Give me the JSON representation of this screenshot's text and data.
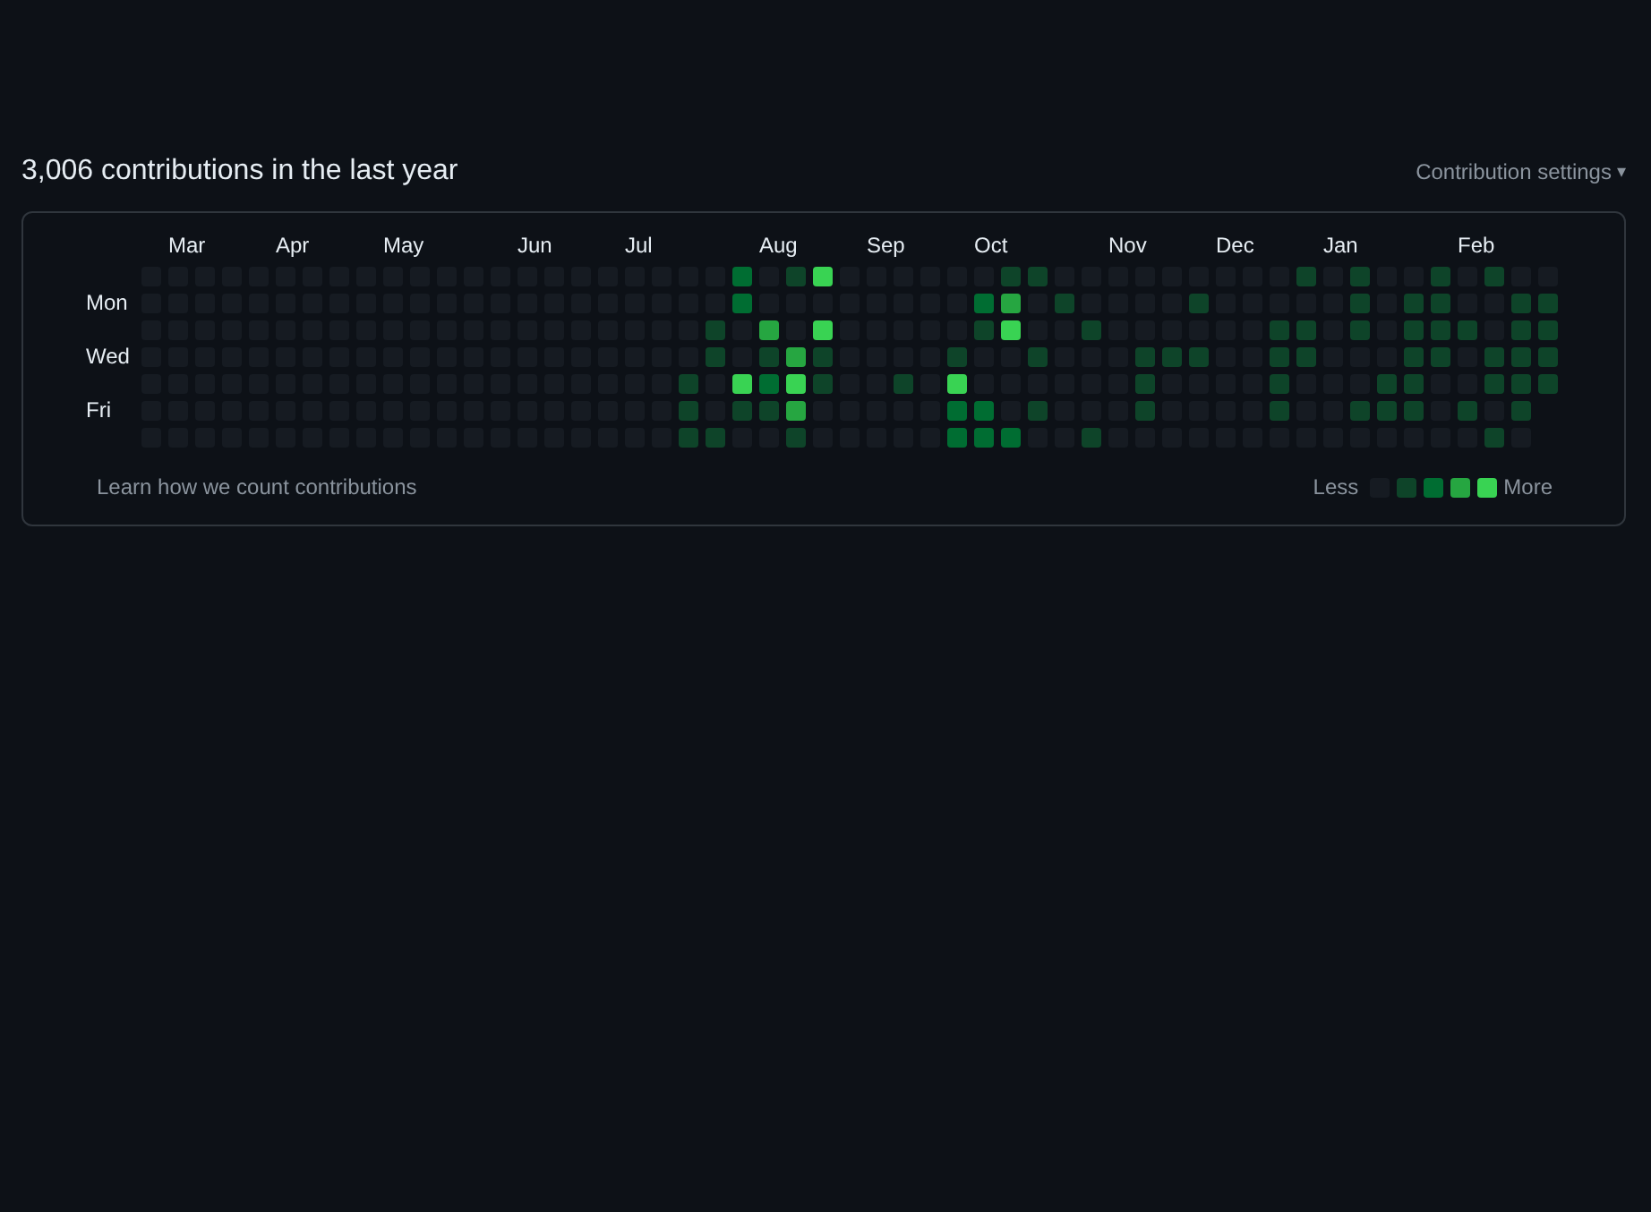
{
  "heading": "3,006 contributions in the last year",
  "settings_menu": {
    "label": "Contribution settings",
    "caret": "▾"
  },
  "weekday_rows": [
    {},
    {
      "label": "Mon"
    },
    {},
    {
      "label": "Wed"
    },
    {},
    {
      "label": "Fri"
    },
    {}
  ],
  "weeks": [
    {
      "days": [
        {
          "color": "#161b22"
        },
        {
          "color": "#161b22"
        },
        {
          "color": "#161b22"
        },
        {
          "color": "#161b22"
        },
        {
          "color": "#161b22"
        },
        {
          "color": "#161b22"
        },
        {
          "color": "#161b22"
        }
      ]
    },
    {
      "month": "Mar",
      "days": [
        {
          "color": "#161b22"
        },
        {
          "color": "#161b22"
        },
        {
          "color": "#161b22"
        },
        {
          "color": "#161b22"
        },
        {
          "color": "#161b22"
        },
        {
          "color": "#161b22"
        },
        {
          "color": "#161b22"
        }
      ]
    },
    {
      "days": [
        {
          "color": "#161b22"
        },
        {
          "color": "#161b22"
        },
        {
          "color": "#161b22"
        },
        {
          "color": "#161b22"
        },
        {
          "color": "#161b22"
        },
        {
          "color": "#161b22"
        },
        {
          "color": "#161b22"
        }
      ]
    },
    {
      "days": [
        {
          "color": "#161b22"
        },
        {
          "color": "#161b22"
        },
        {
          "color": "#161b22"
        },
        {
          "color": "#161b22"
        },
        {
          "color": "#161b22"
        },
        {
          "color": "#161b22"
        },
        {
          "color": "#161b22"
        }
      ]
    },
    {
      "days": [
        {
          "color": "#161b22"
        },
        {
          "color": "#161b22"
        },
        {
          "color": "#161b22"
        },
        {
          "color": "#161b22"
        },
        {
          "color": "#161b22"
        },
        {
          "color": "#161b22"
        },
        {
          "color": "#161b22"
        }
      ]
    },
    {
      "month": "Apr",
      "days": [
        {
          "color": "#161b22"
        },
        {
          "color": "#161b22"
        },
        {
          "color": "#161b22"
        },
        {
          "color": "#161b22"
        },
        {
          "color": "#161b22"
        },
        {
          "color": "#161b22"
        },
        {
          "color": "#161b22"
        }
      ]
    },
    {
      "days": [
        {
          "color": "#161b22"
        },
        {
          "color": "#161b22"
        },
        {
          "color": "#161b22"
        },
        {
          "color": "#161b22"
        },
        {
          "color": "#161b22"
        },
        {
          "color": "#161b22"
        },
        {
          "color": "#161b22"
        }
      ]
    },
    {
      "days": [
        {
          "color": "#161b22"
        },
        {
          "color": "#161b22"
        },
        {
          "color": "#161b22"
        },
        {
          "color": "#161b22"
        },
        {
          "color": "#161b22"
        },
        {
          "color": "#161b22"
        },
        {
          "color": "#161b22"
        }
      ]
    },
    {
      "days": [
        {
          "color": "#161b22"
        },
        {
          "color": "#161b22"
        },
        {
          "color": "#161b22"
        },
        {
          "color": "#161b22"
        },
        {
          "color": "#161b22"
        },
        {
          "color": "#161b22"
        },
        {
          "color": "#161b22"
        }
      ]
    },
    {
      "month": "May",
      "days": [
        {
          "color": "#161b22"
        },
        {
          "color": "#161b22"
        },
        {
          "color": "#161b22"
        },
        {
          "color": "#161b22"
        },
        {
          "color": "#161b22"
        },
        {
          "color": "#161b22"
        },
        {
          "color": "#161b22"
        }
      ]
    },
    {
      "days": [
        {
          "color": "#161b22"
        },
        {
          "color": "#161b22"
        },
        {
          "color": "#161b22"
        },
        {
          "color": "#161b22"
        },
        {
          "color": "#161b22"
        },
        {
          "color": "#161b22"
        },
        {
          "color": "#161b22"
        }
      ]
    },
    {
      "days": [
        {
          "color": "#161b22"
        },
        {
          "color": "#161b22"
        },
        {
          "color": "#161b22"
        },
        {
          "color": "#161b22"
        },
        {
          "color": "#161b22"
        },
        {
          "color": "#161b22"
        },
        {
          "color": "#161b22"
        }
      ]
    },
    {
      "days": [
        {
          "color": "#161b22"
        },
        {
          "color": "#161b22"
        },
        {
          "color": "#161b22"
        },
        {
          "color": "#161b22"
        },
        {
          "color": "#161b22"
        },
        {
          "color": "#161b22"
        },
        {
          "color": "#161b22"
        }
      ]
    },
    {
      "days": [
        {
          "color": "#161b22"
        },
        {
          "color": "#161b22"
        },
        {
          "color": "#161b22"
        },
        {
          "color": "#161b22"
        },
        {
          "color": "#161b22"
        },
        {
          "color": "#161b22"
        },
        {
          "color": "#161b22"
        }
      ]
    },
    {
      "month": "Jun",
      "days": [
        {
          "color": "#161b22"
        },
        {
          "color": "#161b22"
        },
        {
          "color": "#161b22"
        },
        {
          "color": "#161b22"
        },
        {
          "color": "#161b22"
        },
        {
          "color": "#161b22"
        },
        {
          "color": "#161b22"
        }
      ]
    },
    {
      "days": [
        {
          "color": "#161b22"
        },
        {
          "color": "#161b22"
        },
        {
          "color": "#161b22"
        },
        {
          "color": "#161b22"
        },
        {
          "color": "#161b22"
        },
        {
          "color": "#161b22"
        },
        {
          "color": "#161b22"
        }
      ]
    },
    {
      "days": [
        {
          "color": "#161b22"
        },
        {
          "color": "#161b22"
        },
        {
          "color": "#161b22"
        },
        {
          "color": "#161b22"
        },
        {
          "color": "#161b22"
        },
        {
          "color": "#161b22"
        },
        {
          "color": "#161b22"
        }
      ]
    },
    {
      "days": [
        {
          "color": "#161b22"
        },
        {
          "color": "#161b22"
        },
        {
          "color": "#161b22"
        },
        {
          "color": "#161b22"
        },
        {
          "color": "#161b22"
        },
        {
          "color": "#161b22"
        },
        {
          "color": "#161b22"
        }
      ]
    },
    {
      "month": "Jul",
      "days": [
        {
          "color": "#161b22"
        },
        {
          "color": "#161b22"
        },
        {
          "color": "#161b22"
        },
        {
          "color": "#161b22"
        },
        {
          "color": "#161b22"
        },
        {
          "color": "#161b22"
        },
        {
          "color": "#161b22"
        }
      ]
    },
    {
      "days": [
        {
          "color": "#161b22"
        },
        {
          "color": "#161b22"
        },
        {
          "color": "#161b22"
        },
        {
          "color": "#161b22"
        },
        {
          "color": "#161b22"
        },
        {
          "color": "#161b22"
        },
        {
          "color": "#161b22"
        }
      ]
    },
    {
      "days": [
        {
          "color": "#161b22"
        },
        {
          "color": "#161b22"
        },
        {
          "color": "#161b22"
        },
        {
          "color": "#161b22"
        },
        {
          "color": "#0e4429"
        },
        {
          "color": "#0e4429"
        },
        {
          "color": "#0e4429"
        }
      ]
    },
    {
      "days": [
        {
          "color": "#161b22"
        },
        {
          "color": "#161b22"
        },
        {
          "color": "#0e4429"
        },
        {
          "color": "#0e4429"
        },
        {
          "color": "#161b22"
        },
        {
          "color": "#161b22"
        },
        {
          "color": "#0e4429"
        }
      ]
    },
    {
      "days": [
        {
          "color": "#006d32"
        },
        {
          "color": "#006d32"
        },
        {
          "color": "#161b22"
        },
        {
          "color": "#161b22"
        },
        {
          "color": "#39d353"
        },
        {
          "color": "#0e4429"
        },
        {
          "color": "#161b22"
        }
      ]
    },
    {
      "month": "Aug",
      "days": [
        {
          "color": "#161b22"
        },
        {
          "color": "#161b22"
        },
        {
          "color": "#26a641"
        },
        {
          "color": "#0e4429"
        },
        {
          "color": "#006d32"
        },
        {
          "color": "#0e4429"
        },
        {
          "color": "#161b22"
        }
      ]
    },
    {
      "days": [
        {
          "color": "#0e4429"
        },
        {
          "color": "#161b22"
        },
        {
          "color": "#161b22"
        },
        {
          "color": "#26a641"
        },
        {
          "color": "#39d353"
        },
        {
          "color": "#26a641"
        },
        {
          "color": "#0e4429"
        }
      ]
    },
    {
      "days": [
        {
          "color": "#39d353"
        },
        {
          "color": "#161b22"
        },
        {
          "color": "#39d353"
        },
        {
          "color": "#0e4429"
        },
        {
          "color": "#0e4429"
        },
        {
          "color": "#161b22"
        },
        {
          "color": "#161b22"
        }
      ]
    },
    {
      "days": [
        {
          "color": "#161b22"
        },
        {
          "color": "#161b22"
        },
        {
          "color": "#161b22"
        },
        {
          "color": "#161b22"
        },
        {
          "color": "#161b22"
        },
        {
          "color": "#161b22"
        },
        {
          "color": "#161b22"
        }
      ]
    },
    {
      "month": "Sep",
      "days": [
        {
          "color": "#161b22"
        },
        {
          "color": "#161b22"
        },
        {
          "color": "#161b22"
        },
        {
          "color": "#161b22"
        },
        {
          "color": "#161b22"
        },
        {
          "color": "#161b22"
        },
        {
          "color": "#161b22"
        }
      ]
    },
    {
      "days": [
        {
          "color": "#161b22"
        },
        {
          "color": "#161b22"
        },
        {
          "color": "#161b22"
        },
        {
          "color": "#161b22"
        },
        {
          "color": "#0e4429"
        },
        {
          "color": "#161b22"
        },
        {
          "color": "#161b22"
        }
      ]
    },
    {
      "days": [
        {
          "color": "#161b22"
        },
        {
          "color": "#161b22"
        },
        {
          "color": "#161b22"
        },
        {
          "color": "#161b22"
        },
        {
          "color": "#161b22"
        },
        {
          "color": "#161b22"
        },
        {
          "color": "#161b22"
        }
      ]
    },
    {
      "days": [
        {
          "color": "#161b22"
        },
        {
          "color": "#161b22"
        },
        {
          "color": "#161b22"
        },
        {
          "color": "#0e4429"
        },
        {
          "color": "#39d353"
        },
        {
          "color": "#006d32"
        },
        {
          "color": "#006d32"
        }
      ]
    },
    {
      "month": "Oct",
      "days": [
        {
          "color": "#161b22"
        },
        {
          "color": "#006d32"
        },
        {
          "color": "#0e4429"
        },
        {
          "color": "#161b22"
        },
        {
          "color": "#161b22"
        },
        {
          "color": "#006d32"
        },
        {
          "color": "#006d32"
        }
      ]
    },
    {
      "days": [
        {
          "color": "#0e4429"
        },
        {
          "color": "#26a641"
        },
        {
          "color": "#39d353"
        },
        {
          "color": "#161b22"
        },
        {
          "color": "#161b22"
        },
        {
          "color": "#161b22"
        },
        {
          "color": "#006d32"
        }
      ]
    },
    {
      "days": [
        {
          "color": "#0e4429"
        },
        {
          "color": "#161b22"
        },
        {
          "color": "#161b22"
        },
        {
          "color": "#0e4429"
        },
        {
          "color": "#161b22"
        },
        {
          "color": "#0e4429"
        },
        {
          "color": "#161b22"
        }
      ]
    },
    {
      "days": [
        {
          "color": "#161b22"
        },
        {
          "color": "#0e4429"
        },
        {
          "color": "#161b22"
        },
        {
          "color": "#161b22"
        },
        {
          "color": "#161b22"
        },
        {
          "color": "#161b22"
        },
        {
          "color": "#161b22"
        }
      ]
    },
    {
      "days": [
        {
          "color": "#161b22"
        },
        {
          "color": "#161b22"
        },
        {
          "color": "#0e4429"
        },
        {
          "color": "#161b22"
        },
        {
          "color": "#161b22"
        },
        {
          "color": "#161b22"
        },
        {
          "color": "#0e4429"
        }
      ]
    },
    {
      "month": "Nov",
      "days": [
        {
          "color": "#161b22"
        },
        {
          "color": "#161b22"
        },
        {
          "color": "#161b22"
        },
        {
          "color": "#161b22"
        },
        {
          "color": "#161b22"
        },
        {
          "color": "#161b22"
        },
        {
          "color": "#161b22"
        }
      ]
    },
    {
      "days": [
        {
          "color": "#161b22"
        },
        {
          "color": "#161b22"
        },
        {
          "color": "#161b22"
        },
        {
          "color": "#0e4429"
        },
        {
          "color": "#0e4429"
        },
        {
          "color": "#0e4429"
        },
        {
          "color": "#161b22"
        }
      ]
    },
    {
      "days": [
        {
          "color": "#161b22"
        },
        {
          "color": "#161b22"
        },
        {
          "color": "#161b22"
        },
        {
          "color": "#0e4429"
        },
        {
          "color": "#161b22"
        },
        {
          "color": "#161b22"
        },
        {
          "color": "#161b22"
        }
      ]
    },
    {
      "days": [
        {
          "color": "#161b22"
        },
        {
          "color": "#0e4429"
        },
        {
          "color": "#161b22"
        },
        {
          "color": "#0e4429"
        },
        {
          "color": "#161b22"
        },
        {
          "color": "#161b22"
        },
        {
          "color": "#161b22"
        }
      ]
    },
    {
      "month": "Dec",
      "days": [
        {
          "color": "#161b22"
        },
        {
          "color": "#161b22"
        },
        {
          "color": "#161b22"
        },
        {
          "color": "#161b22"
        },
        {
          "color": "#161b22"
        },
        {
          "color": "#161b22"
        },
        {
          "color": "#161b22"
        }
      ]
    },
    {
      "days": [
        {
          "color": "#161b22"
        },
        {
          "color": "#161b22"
        },
        {
          "color": "#161b22"
        },
        {
          "color": "#161b22"
        },
        {
          "color": "#161b22"
        },
        {
          "color": "#161b22"
        },
        {
          "color": "#161b22"
        }
      ]
    },
    {
      "days": [
        {
          "color": "#161b22"
        },
        {
          "color": "#161b22"
        },
        {
          "color": "#0e4429"
        },
        {
          "color": "#0e4429"
        },
        {
          "color": "#0e4429"
        },
        {
          "color": "#0e4429"
        },
        {
          "color": "#161b22"
        }
      ]
    },
    {
      "days": [
        {
          "color": "#0e4429"
        },
        {
          "color": "#161b22"
        },
        {
          "color": "#0e4429"
        },
        {
          "color": "#0e4429"
        },
        {
          "color": "#161b22"
        },
        {
          "color": "#161b22"
        },
        {
          "color": "#161b22"
        }
      ]
    },
    {
      "month": "Jan",
      "days": [
        {
          "color": "#161b22"
        },
        {
          "color": "#161b22"
        },
        {
          "color": "#161b22"
        },
        {
          "color": "#161b22"
        },
        {
          "color": "#161b22"
        },
        {
          "color": "#161b22"
        },
        {
          "color": "#161b22"
        }
      ]
    },
    {
      "days": [
        {
          "color": "#0e4429"
        },
        {
          "color": "#0e4429"
        },
        {
          "color": "#0e4429"
        },
        {
          "color": "#161b22"
        },
        {
          "color": "#161b22"
        },
        {
          "color": "#0e4429"
        },
        {
          "color": "#161b22"
        }
      ]
    },
    {
      "days": [
        {
          "color": "#161b22"
        },
        {
          "color": "#161b22"
        },
        {
          "color": "#161b22"
        },
        {
          "color": "#161b22"
        },
        {
          "color": "#0e4429"
        },
        {
          "color": "#0e4429"
        },
        {
          "color": "#161b22"
        }
      ]
    },
    {
      "days": [
        {
          "color": "#161b22"
        },
        {
          "color": "#0e4429"
        },
        {
          "color": "#0e4429"
        },
        {
          "color": "#0e4429"
        },
        {
          "color": "#0e4429"
        },
        {
          "color": "#0e4429"
        },
        {
          "color": "#161b22"
        }
      ]
    },
    {
      "days": [
        {
          "color": "#0e4429"
        },
        {
          "color": "#0e4429"
        },
        {
          "color": "#0e4429"
        },
        {
          "color": "#0e4429"
        },
        {
          "color": "#161b22"
        },
        {
          "color": "#161b22"
        },
        {
          "color": "#161b22"
        }
      ]
    },
    {
      "month": "Feb",
      "days": [
        {
          "color": "#161b22"
        },
        {
          "color": "#161b22"
        },
        {
          "color": "#0e4429"
        },
        {
          "color": "#161b22"
        },
        {
          "color": "#161b22"
        },
        {
          "color": "#0e4429"
        },
        {
          "color": "#161b22"
        }
      ]
    },
    {
      "days": [
        {
          "color": "#0e4429"
        },
        {
          "color": "#161b22"
        },
        {
          "color": "#161b22"
        },
        {
          "color": "#0e4429"
        },
        {
          "color": "#0e4429"
        },
        {
          "color": "#161b22"
        },
        {
          "color": "#0e4429"
        }
      ]
    },
    {
      "days": [
        {
          "color": "#161b22"
        },
        {
          "color": "#0e4429"
        },
        {
          "color": "#0e4429"
        },
        {
          "color": "#0e4429"
        },
        {
          "color": "#0e4429"
        },
        {
          "color": "#0e4429"
        },
        {
          "color": "#161b22"
        }
      ]
    },
    {
      "days": [
        {
          "color": "#161b22"
        },
        {
          "color": "#0e4429"
        },
        {
          "color": "#0e4429"
        },
        {
          "color": "#0e4429"
        },
        {
          "color": "#0e4429"
        }
      ]
    }
  ],
  "footer": {
    "link": "Learn how we count contributions",
    "less": "Less",
    "more": "More",
    "legend": [
      {
        "color": "#161b22"
      },
      {
        "color": "#0e4429"
      },
      {
        "color": "#006d32"
      },
      {
        "color": "#26a641"
      },
      {
        "color": "#39d353"
      }
    ]
  }
}
